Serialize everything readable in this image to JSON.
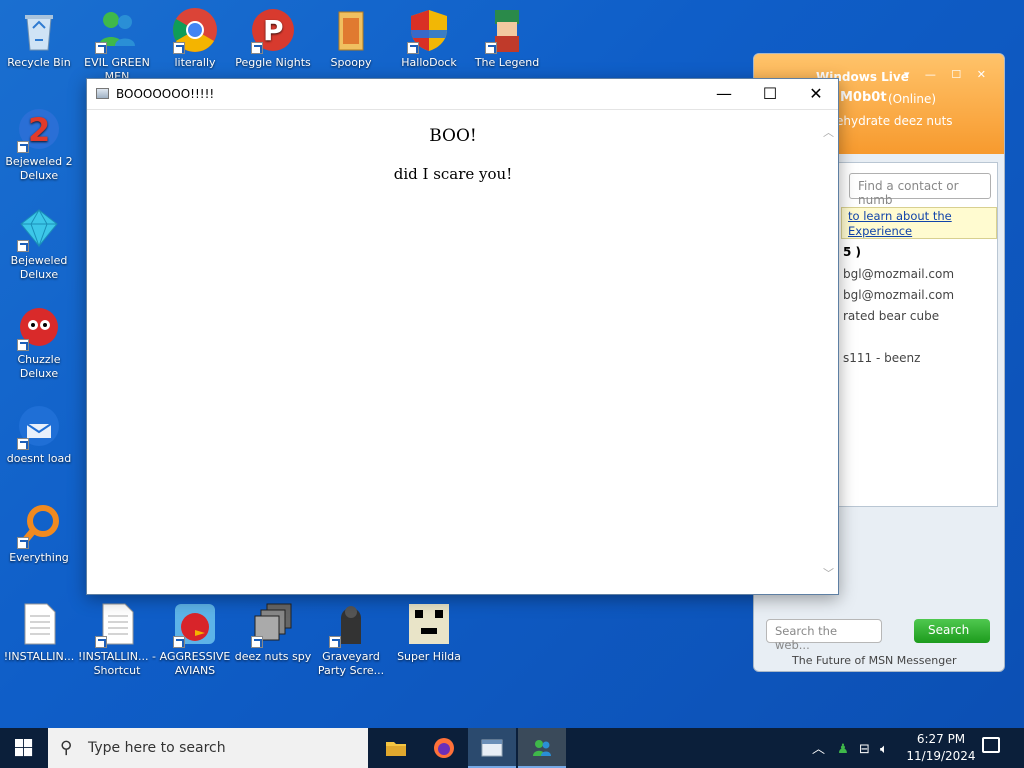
{
  "desktop": {
    "icons": [
      {
        "label": "Recycle Bin"
      },
      {
        "label": "EVIL GREEN MEN"
      },
      {
        "label": "literally"
      },
      {
        "label": "Peggle Nights"
      },
      {
        "label": "Spoopy"
      },
      {
        "label": "HalloDock"
      },
      {
        "label": "The Legend"
      },
      {
        "label": "Bejeweled 2 Deluxe"
      },
      {
        "label": "Bejeweled Deluxe"
      },
      {
        "label": "Chuzzle Deluxe"
      },
      {
        "label": "doesnt load"
      },
      {
        "label": "Everything"
      },
      {
        "label": "!INSTALLIN..."
      },
      {
        "label": "!INSTALLIN... - Shortcut"
      },
      {
        "label": "AGGRESSIVE AVIANS"
      },
      {
        "label": "deez nuts spy"
      },
      {
        "label": "Graveyard Party Scre..."
      },
      {
        "label": "Super Hilda"
      }
    ]
  },
  "dialog": {
    "title": "BOOOOOOO!!!!!",
    "heading": "BOO!",
    "message": "did I scare you!",
    "minimize": "—",
    "maximize": "☐",
    "close": "✕"
  },
  "msn": {
    "app_title": "Windows Live",
    "username": "M0b0t",
    "status": "(Online)",
    "personal_message": "ehydrate deez nuts",
    "find_placeholder": "Find a contact or numb",
    "banner_line1": "to learn about the",
    "banner_line2": "Experience",
    "contacts": [
      "5 )",
      "bgl@mozmail.com",
      "bgl@mozmail.com",
      "rated bear cube",
      "s111 - beenz"
    ],
    "search_placeholder": "Search the web...",
    "search_button": "Search",
    "footer": "The Future of MSN Messenger"
  },
  "taskbar": {
    "search_placeholder": "Type here to search",
    "time": "6:27 PM",
    "date": "11/19/2024"
  },
  "colors": {
    "desktop_bg": "#1462c8",
    "taskbar_bg": "#0b1f3a",
    "msn_orange": "#f79a2e"
  }
}
